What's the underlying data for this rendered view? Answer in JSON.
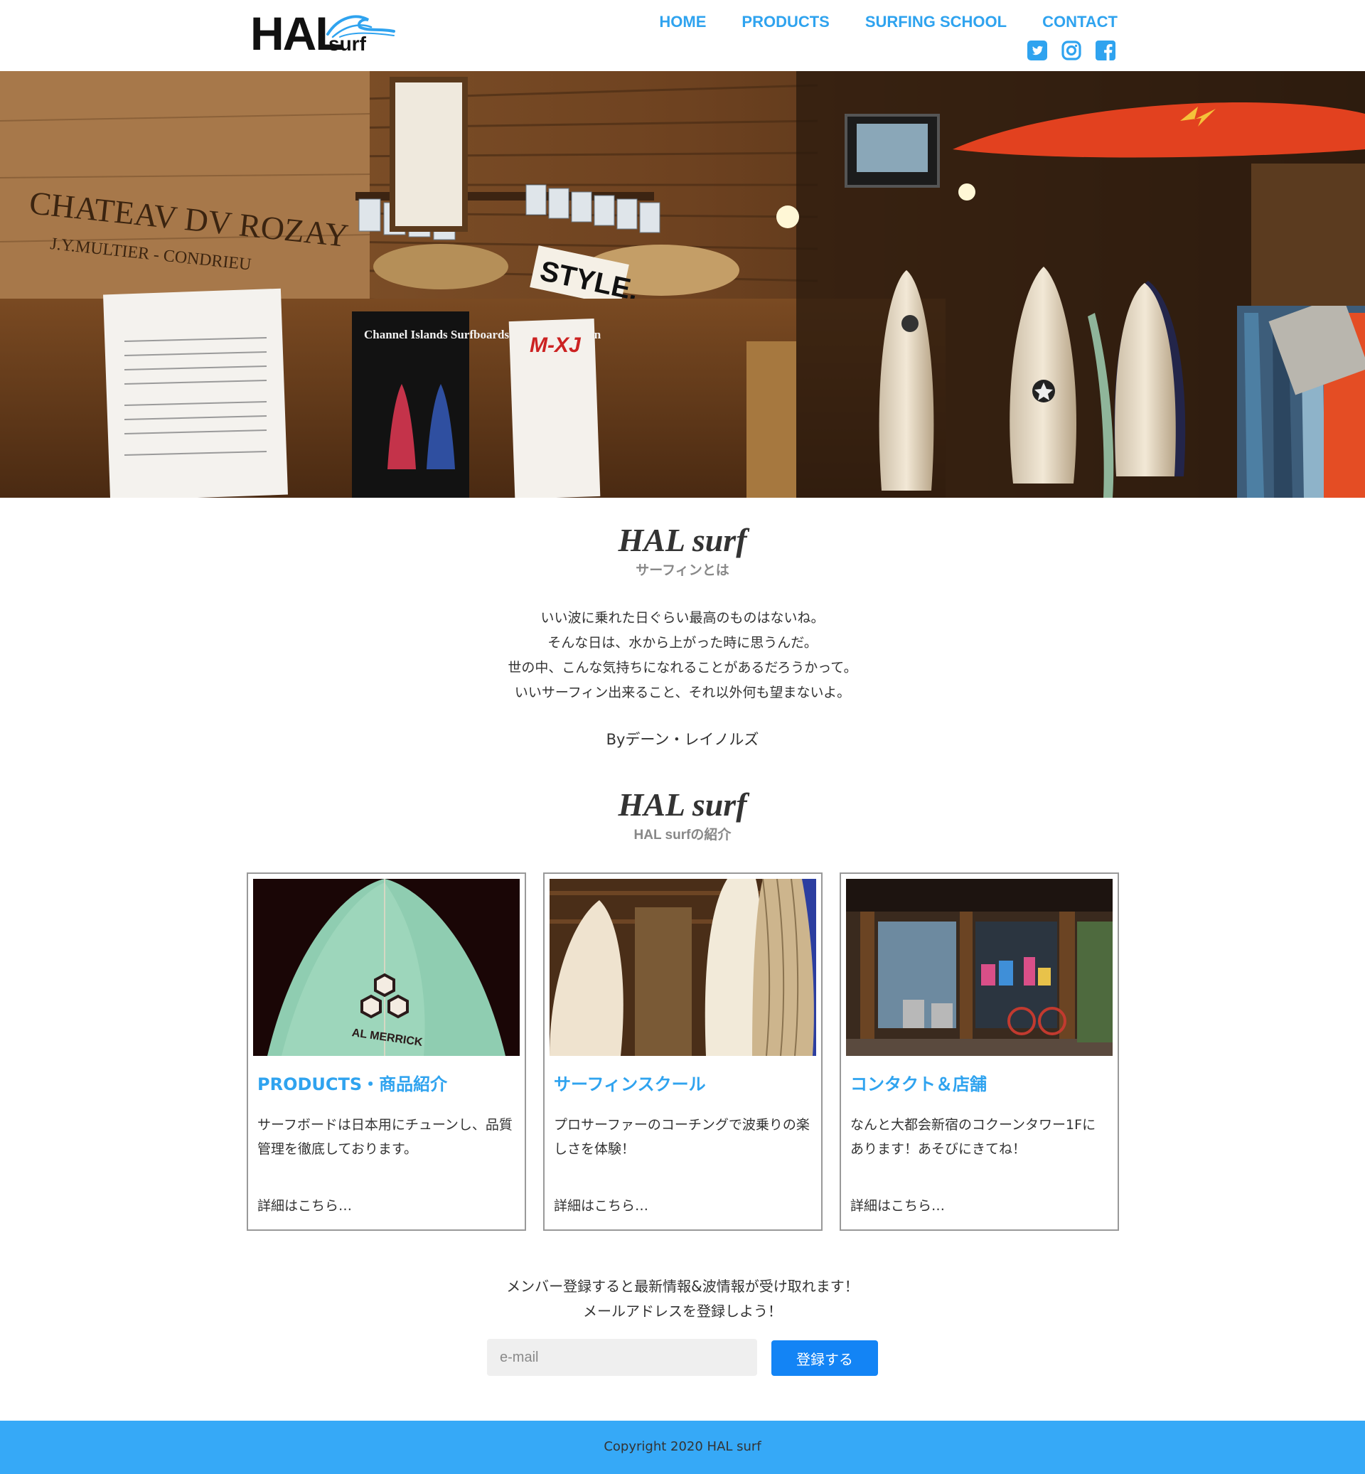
{
  "header": {
    "logo": {
      "main": "HAL",
      "sub": "surf"
    },
    "nav": [
      {
        "label": "HOME"
      },
      {
        "label": "PRODUCTS"
      },
      {
        "label": "SURFING SCHOOL"
      },
      {
        "label": "CONTACT"
      }
    ],
    "social": [
      "twitter-icon",
      "instagram-icon",
      "facebook-icon"
    ],
    "colors": {
      "accent": "#2fa3ef"
    }
  },
  "intro": {
    "title": "HAL surf",
    "subtitle": "サーフィンとは",
    "quote_lines": [
      "いい波に乗れた日ぐらい最高のものはないね。",
      "そんな日は、水から上がった時に思うんだ。",
      "世の中、こんな気持ちになれることがあるだろうかって。",
      "いいサーフィン出来ること、それ以外何も望まないよ。"
    ],
    "by": "Byデーン・レイノルズ"
  },
  "about": {
    "title": "HAL surf",
    "subtitle": "HAL surfの紹介",
    "cards": [
      {
        "title": "PRODUCTS・商品紹介",
        "text": "サーフボードは日本用にチューンし、品質管理を徹底しております。",
        "link": "詳細はこちら…",
        "image_text": "AL MERRICK"
      },
      {
        "title": "サーフィンスクール",
        "text": "プロサーファーのコーチングで波乗りの楽しさを体験！",
        "link": "詳細はこちら…"
      },
      {
        "title": "コンタクト＆店舗",
        "text": "なんと大都会新宿のコクーンタワー1Fにあります！あそびにきてね！",
        "link": "詳細はこちら…"
      }
    ]
  },
  "hero": {
    "sign_line1": "CHATEAV DV ROZAY",
    "sign_line2": "J.Y.MULTIER - CONDRIEU",
    "poster_title": "Channel Islands Surfboards Order Campaign",
    "poster2_title": "M-XJ",
    "style_sign": "STYLE."
  },
  "signup": {
    "line1": "メンバー登録すると最新情報&波情報が受け取れます！",
    "line2": "メールアドレスを登録しよう！",
    "placeholder": "e-mail",
    "button": "登録する",
    "button_color": "#1384f5"
  },
  "footer": {
    "copyright": "Copyright 2020 HAL surf",
    "color": "#36a9f7"
  }
}
